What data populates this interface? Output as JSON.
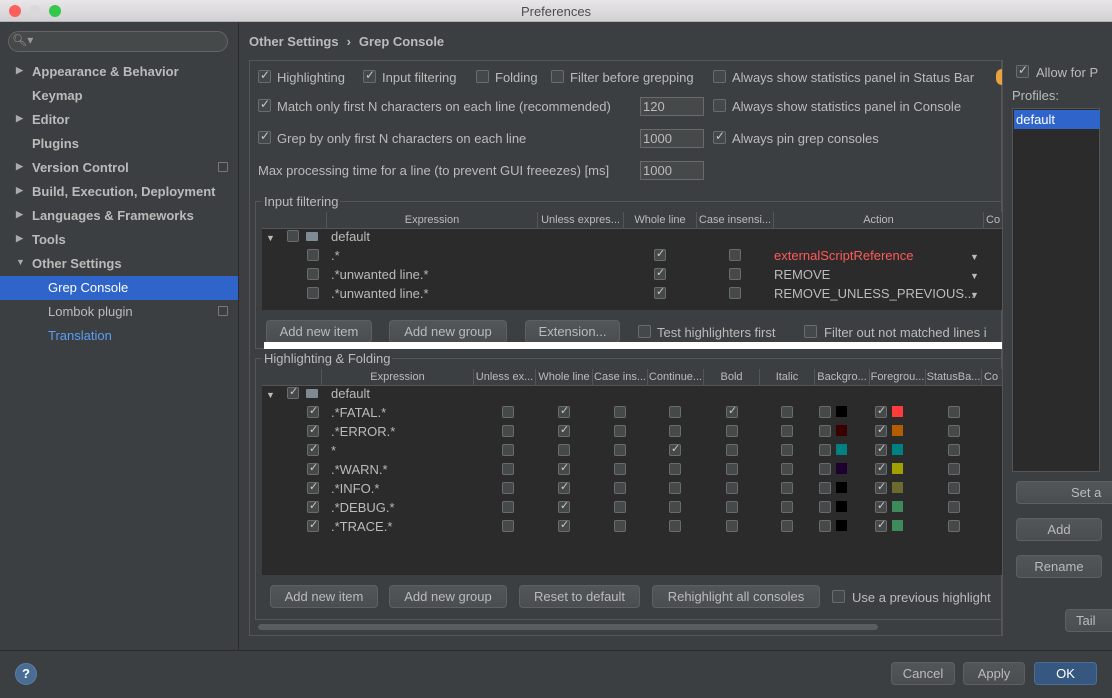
{
  "window": {
    "title": "Preferences"
  },
  "sidebar": {
    "search_placeholder": "",
    "items": [
      {
        "label": "Appearance & Behavior"
      },
      {
        "label": "Keymap"
      },
      {
        "label": "Editor"
      },
      {
        "label": "Plugins"
      },
      {
        "label": "Version Control"
      },
      {
        "label": "Build, Execution, Deployment"
      },
      {
        "label": "Languages & Frameworks"
      },
      {
        "label": "Tools"
      },
      {
        "label": "Other Settings"
      },
      {
        "label": "Grep Console"
      },
      {
        "label": "Lombok plugin"
      },
      {
        "label": "Translation"
      }
    ]
  },
  "breadcrumb": {
    "parent": "Other Settings",
    "separator": "›",
    "current": "Grep Console"
  },
  "options": {
    "highlighting": "Highlighting",
    "input_filtering": "Input filtering",
    "folding": "Folding",
    "filter_before_grepping": "Filter before grepping",
    "always_stats_status_bar": "Always show statistics panel in Status Bar",
    "match_first_n": "Match only first N characters on each line (recommended)",
    "match_first_n_value": "120",
    "always_stats_console": "Always show statistics panel in Console",
    "grep_first_n": "Grep by only first N characters on each line",
    "grep_first_n_value": "1000",
    "always_pin": "Always pin grep consoles",
    "max_time": "Max processing time for a line (to prevent GUI freeezes) [ms]",
    "max_time_value": "1000"
  },
  "input_filtering": {
    "title": "Input filtering",
    "headers": [
      "Expression",
      "Unless expres...",
      "Whole line",
      "Case insensi...",
      "Action",
      "Co"
    ],
    "group": "default",
    "rows": [
      {
        "expr": ".*",
        "action": "externalScriptReference",
        "action_color": "#ff5a5a"
      },
      {
        "expr": ".*unwanted line.*",
        "action": "REMOVE",
        "action_color": "#bbbbbb"
      },
      {
        "expr": ".*unwanted line.*",
        "action": "REMOVE_UNLESS_PREVIOUS...",
        "action_color": "#bbbbbb"
      }
    ],
    "buttons": {
      "add_item": "Add new item",
      "add_group": "Add new group",
      "extension": "Extension...",
      "test_first": "Test highlighters first",
      "filter_out": "Filter out not matched lines i"
    }
  },
  "highlighting": {
    "title": "Highlighting & Folding",
    "headers": [
      "Expression",
      "Unless ex...",
      "Whole line",
      "Case ins...",
      "Continue...",
      "Bold",
      "Italic",
      "Backgro...",
      "Foregrou...",
      "StatusBa...",
      "Co"
    ],
    "group": "default",
    "rows": [
      {
        "expr": ".*FATAL.*",
        "whole": true,
        "cont": false,
        "bold": true,
        "bg": "#000000",
        "fg": "#ff3b3b"
      },
      {
        "expr": ".*ERROR.*",
        "whole": true,
        "cont": false,
        "bold": false,
        "bg": "#3a0000",
        "fg": "#b35c00"
      },
      {
        "expr": "*",
        "whole": false,
        "cont": true,
        "bold": false,
        "bg": "#008080",
        "fg": "#008080"
      },
      {
        "expr": ".*WARN.*",
        "whole": true,
        "cont": false,
        "bold": false,
        "bg": "#1e0030",
        "fg": "#a0a000"
      },
      {
        "expr": ".*INFO.*",
        "whole": true,
        "cont": false,
        "bold": false,
        "bg": "#000000",
        "fg": "#6b6b30"
      },
      {
        "expr": ".*DEBUG.*",
        "whole": true,
        "cont": false,
        "bold": false,
        "bg": "#000000",
        "fg": "#3f8a5a"
      },
      {
        "expr": ".*TRACE.*",
        "whole": true,
        "cont": false,
        "bold": false,
        "bg": "#000000",
        "fg": "#3f8a5a"
      }
    ],
    "buttons": {
      "add_item": "Add new item",
      "add_group": "Add new group",
      "reset": "Reset to default",
      "rehighlight": "Rehighlight all consoles",
      "use_previous": "Use a previous highlight"
    }
  },
  "right": {
    "allow": "Allow for P",
    "profiles_label": "Profiles:",
    "profile_selected": "default",
    "set": "Set a",
    "add": "Add",
    "rename": "Rename",
    "tail": "Tail"
  },
  "footer": {
    "help": "?",
    "cancel": "Cancel",
    "apply": "Apply",
    "ok": "OK"
  }
}
